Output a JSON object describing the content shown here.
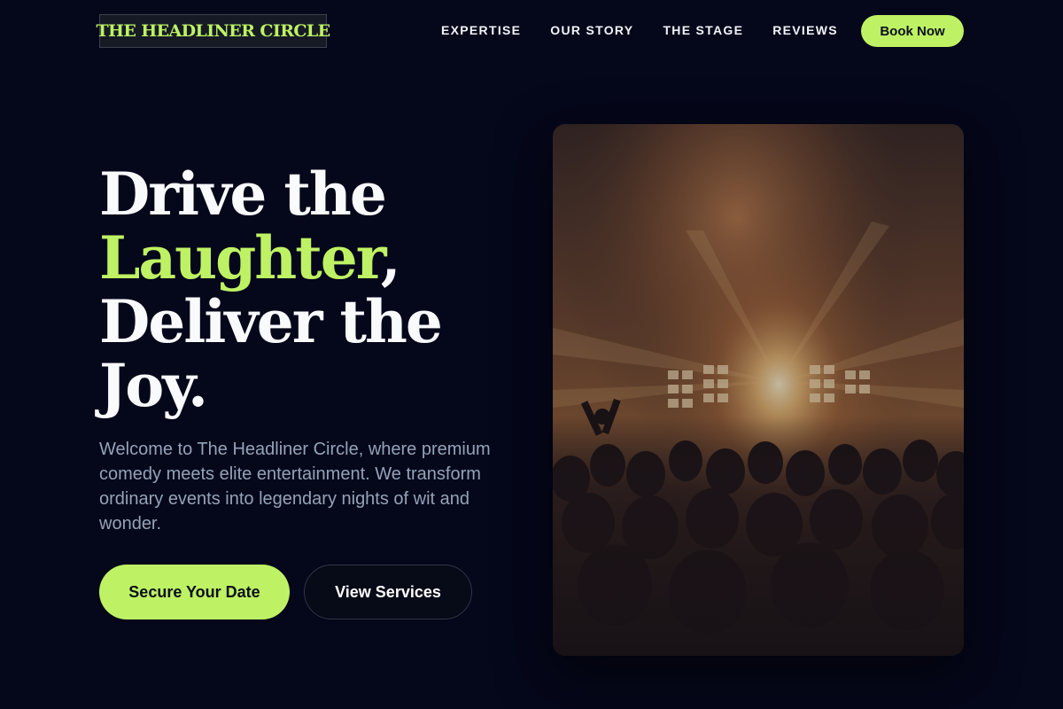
{
  "brand": {
    "name": "THE HEADLINER CIRCLE"
  },
  "nav": {
    "links": [
      "EXPERTISE",
      "OUR STORY",
      "THE STAGE",
      "REVIEWS"
    ],
    "cta": "Book Now"
  },
  "hero": {
    "title_line1": "Drive the",
    "title_accent": "Laughter",
    "title_comma": ",",
    "title_line3": "Deliver the",
    "title_line4": "Joy.",
    "description": "Welcome to The Headliner Circle, where premium comedy meets elite entertainment. We transform ordinary events into legendary nights of wit and wonder.",
    "primary_button": "Secure Your Date",
    "secondary_button": "View Services"
  },
  "colors": {
    "background": "#05071a",
    "accent": "#bef264",
    "muted_text": "#94a3b8"
  },
  "image": {
    "subject": "concert-crowd-stage-lights-photo"
  }
}
